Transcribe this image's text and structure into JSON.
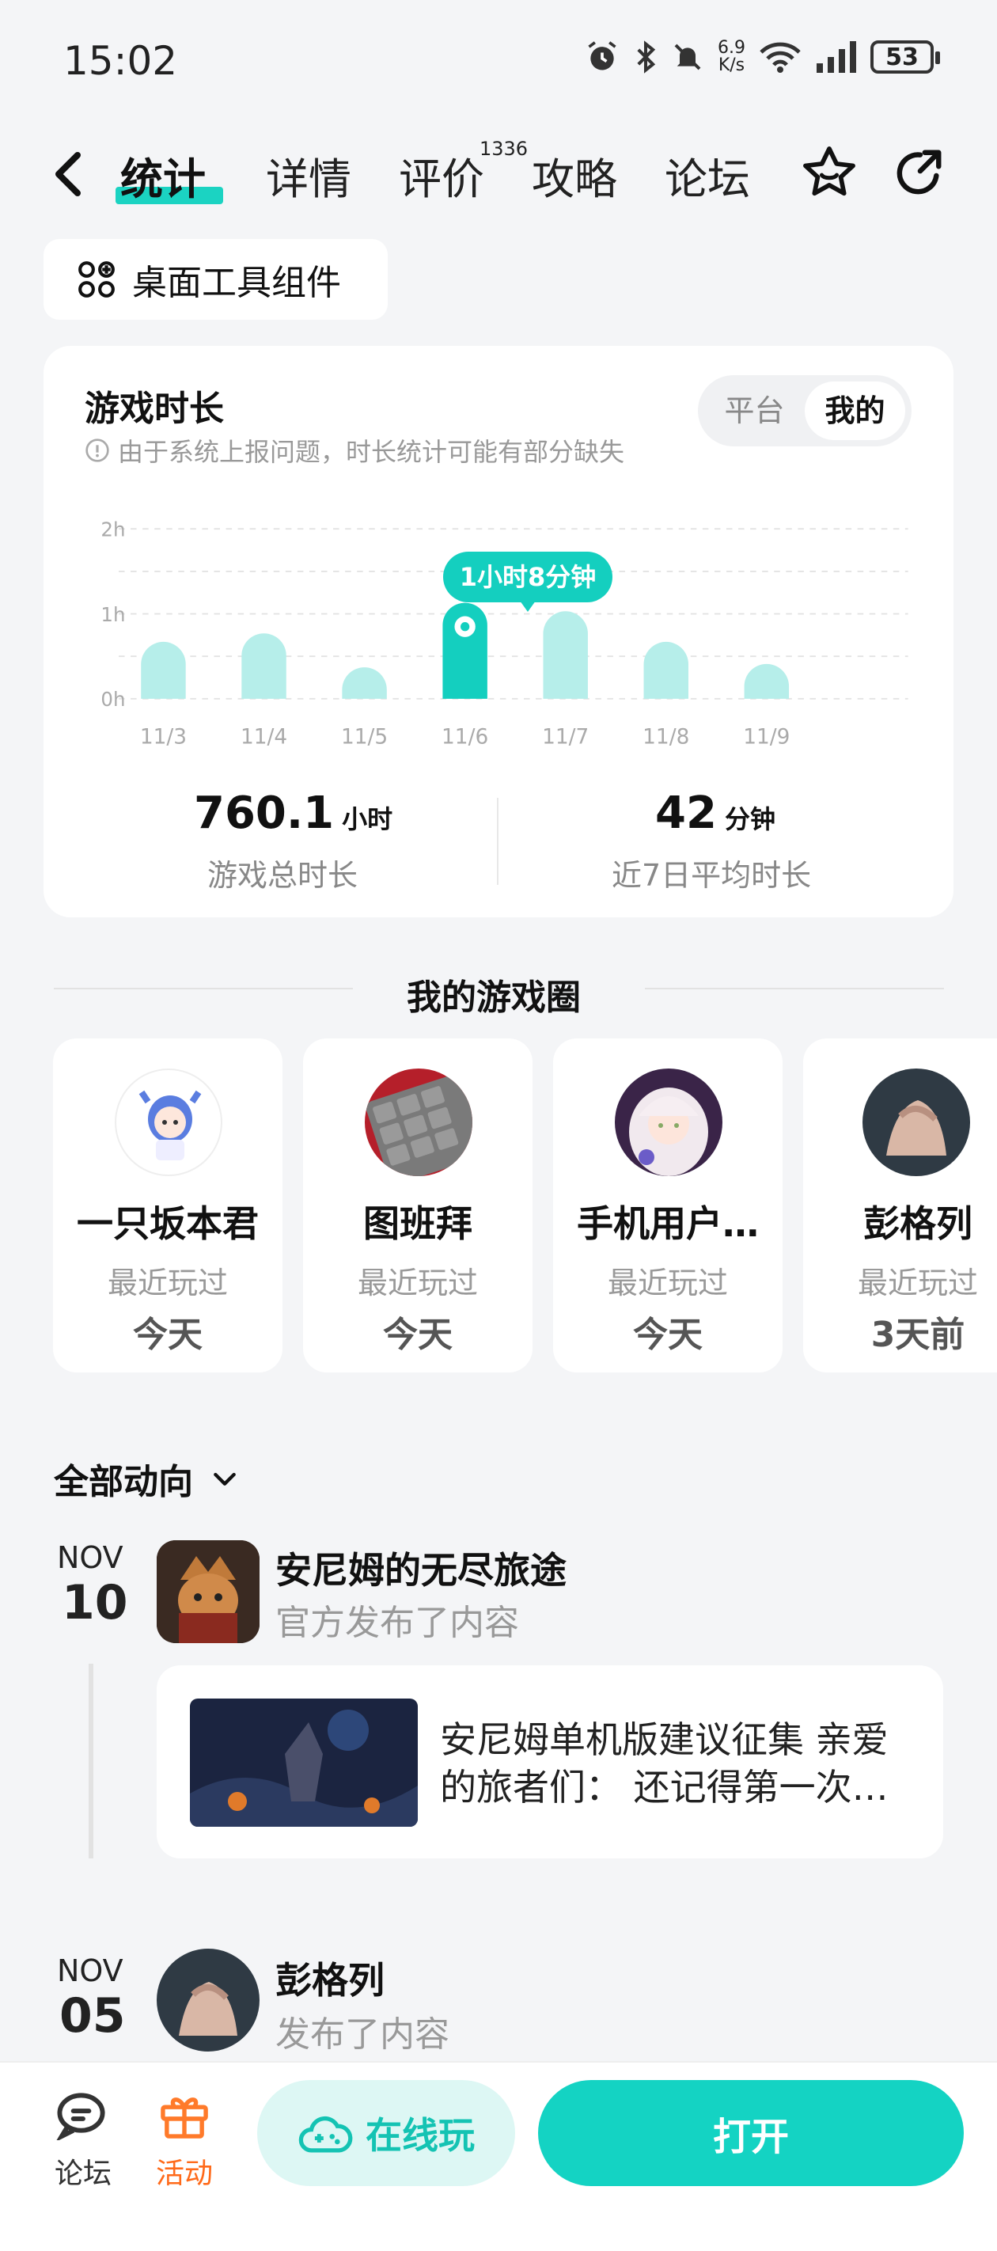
{
  "status": {
    "time": "15:02",
    "net_speed_value": "6.9",
    "net_speed_unit": "K/s",
    "battery": "53",
    "wifi_label": "6"
  },
  "nav": {
    "tabs": [
      "统计",
      "详情",
      "评价",
      "攻略",
      "论坛"
    ],
    "review_count": "1336",
    "active_tab": "统计"
  },
  "widget": {
    "label": "桌面工具组件"
  },
  "playtime": {
    "title": "游戏时长",
    "note": "由于系统上报问题，时长统计可能有部分缺失",
    "segment": [
      "平台",
      "我的"
    ],
    "segment_selected": "我的",
    "tooltip": "1小时8分钟",
    "total_value": "760.1",
    "total_unit": "小时",
    "total_label": "游戏总时长",
    "avg_value": "42",
    "avg_unit": "分钟",
    "avg_label": "近7日平均时长",
    "accent": "#14cfbf"
  },
  "chart_data": {
    "type": "bar",
    "categories": [
      "11/3",
      "11/4",
      "11/5",
      "11/6",
      "11/7",
      "11/8",
      "11/9"
    ],
    "values": [
      0.67,
      0.77,
      0.37,
      1.13,
      1.03,
      0.67,
      0.41
    ],
    "yticks": [
      "0h",
      "1h",
      "2h"
    ],
    "ylim": [
      0,
      2
    ],
    "highlight_index": 3,
    "grid": true
  },
  "circle": {
    "title": "我的游戏圈",
    "items": [
      {
        "name": "一只坂本君",
        "label": "最近玩过",
        "when": "今天"
      },
      {
        "name": "图班拜",
        "label": "最近玩过",
        "when": "今天"
      },
      {
        "name": "手机用户…",
        "label": "最近玩过",
        "when": "今天"
      },
      {
        "name": "彭格列",
        "label": "最近玩过",
        "when": "3天前"
      }
    ]
  },
  "feed": {
    "filter": "全部动向",
    "posts": [
      {
        "month": "NOV",
        "day": "10",
        "title": "安尼姆的无尽旅途",
        "sub": "官方发布了内容",
        "excerpt": "安尼姆单机版建议征集 亲爱的旅者们：  还记得第一次…"
      },
      {
        "month": "NOV",
        "day": "05",
        "title": "彭格列",
        "sub": "发布了内容"
      }
    ]
  },
  "bottom": {
    "forum": "论坛",
    "activity": "活动",
    "play_online": "在线玩",
    "open": "打开"
  }
}
